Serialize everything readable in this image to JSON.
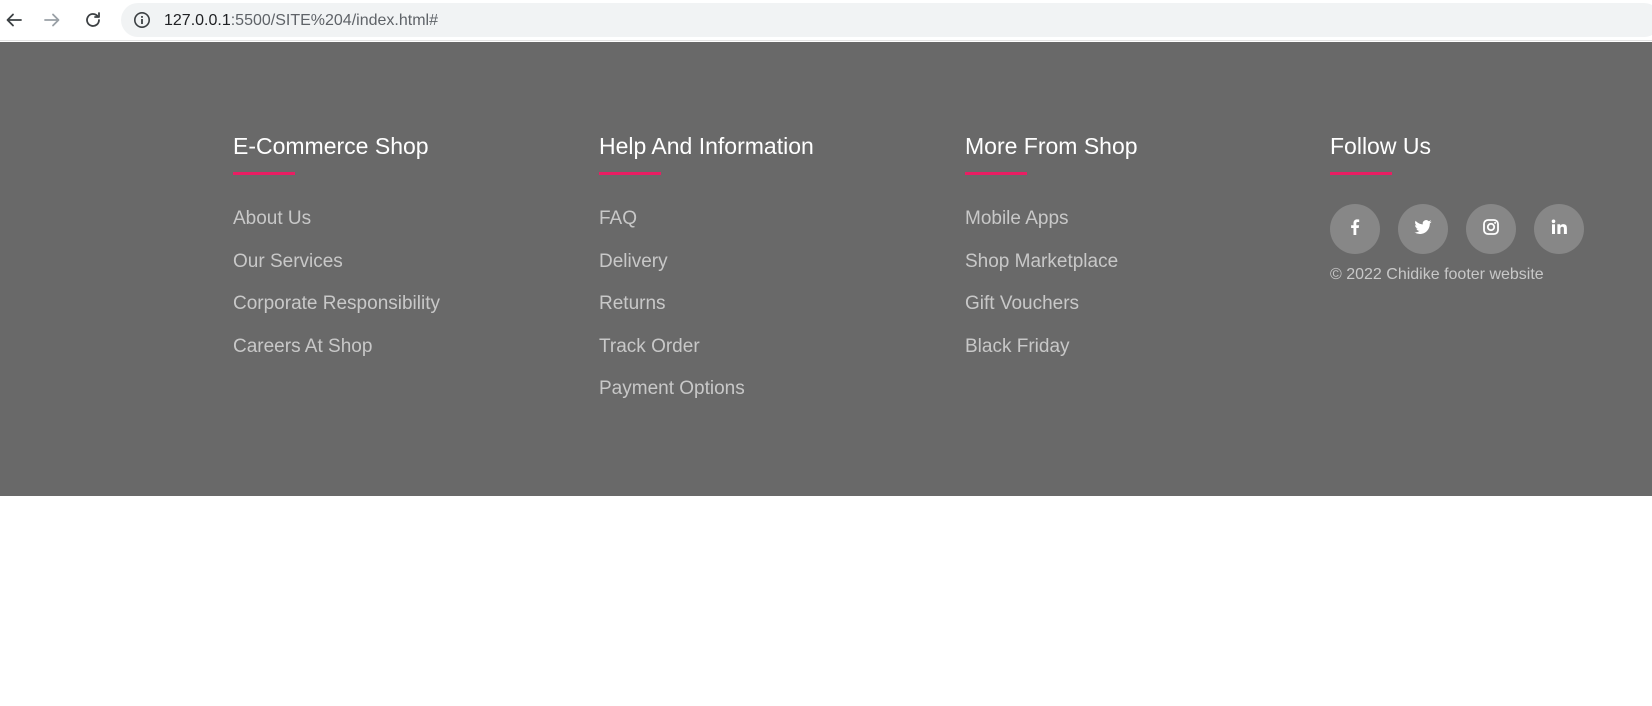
{
  "browser": {
    "url_host": "127.0.0.1",
    "url_rest": ":5500/SITE%204/index.html#",
    "icons": [
      "back-arrow-icon",
      "forward-arrow-icon",
      "reload-icon",
      "site-info-icon"
    ]
  },
  "footer": {
    "accent_color": "#e91e63",
    "background_color": "#696969",
    "columns": [
      {
        "title": "E-Commerce Shop",
        "links": [
          "About Us",
          "Our Services",
          "Corporate Responsibility",
          "Careers At Shop"
        ]
      },
      {
        "title": "Help And Information",
        "links": [
          "FAQ",
          "Delivery",
          "Returns",
          "Track Order",
          "Payment Options"
        ]
      },
      {
        "title": "More From Shop",
        "links": [
          "Mobile Apps",
          "Shop Marketplace",
          "Gift Vouchers",
          "Black Friday"
        ]
      }
    ],
    "follow": {
      "title": "Follow Us",
      "socials": [
        "facebook-icon",
        "twitter-icon",
        "instagram-icon",
        "linkedin-icon"
      ],
      "copyright": "© 2022 Chidike footer website"
    }
  }
}
